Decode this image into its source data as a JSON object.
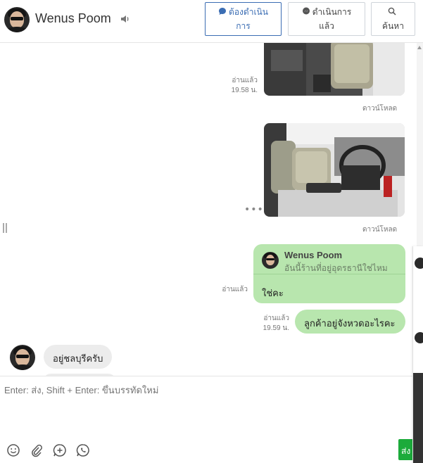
{
  "header": {
    "contact_name": "Wenus Poom",
    "buttons": [
      {
        "label_line1": "ต้องดำเนิน",
        "label_line2": "การ",
        "icon": "chat-bubble-icon"
      },
      {
        "label_line1": "ดำเนินการ",
        "label_line2": "แล้ว",
        "icon": "messenger-icon"
      },
      {
        "label_line1": "",
        "label_line2": "ค้นหา",
        "icon": "search-icon"
      }
    ]
  },
  "messages": {
    "photo1": {
      "status": "อ่านแล้ว",
      "time": "19.58 น.",
      "download": "ดาวน์โหลด"
    },
    "photo2": {
      "download": "ดาวน์โหลด",
      "more": "•••"
    },
    "reply": {
      "quoted_name": "Wenus Poom",
      "quoted_text": "อันนี้ร้านที่อยู่อุดรธานีใช่ไหม",
      "text": "ใช่คะ",
      "status": "อ่านแล้ว"
    },
    "outgoing": {
      "text": "ลูกค้าอยู่จังหวดอะไรคะ",
      "status": "อ่านแล้ว",
      "time": "19.59 น."
    },
    "incoming": {
      "text": "อยู่ชลบุรีครับ"
    }
  },
  "composer": {
    "placeholder": "Enter: ส่ง, Shift + Enter: ขึ้นบรรทัดใหม่",
    "send_label": "ส่ง",
    "tools": [
      "emoji-icon",
      "attach-icon",
      "add-icon",
      "whatsapp-icon"
    ]
  },
  "colors": {
    "accent": "#3b6db3",
    "outgoing_bubble": "#b8e6ae",
    "incoming_bubble": "#ececec",
    "send": "#1cab3b"
  }
}
